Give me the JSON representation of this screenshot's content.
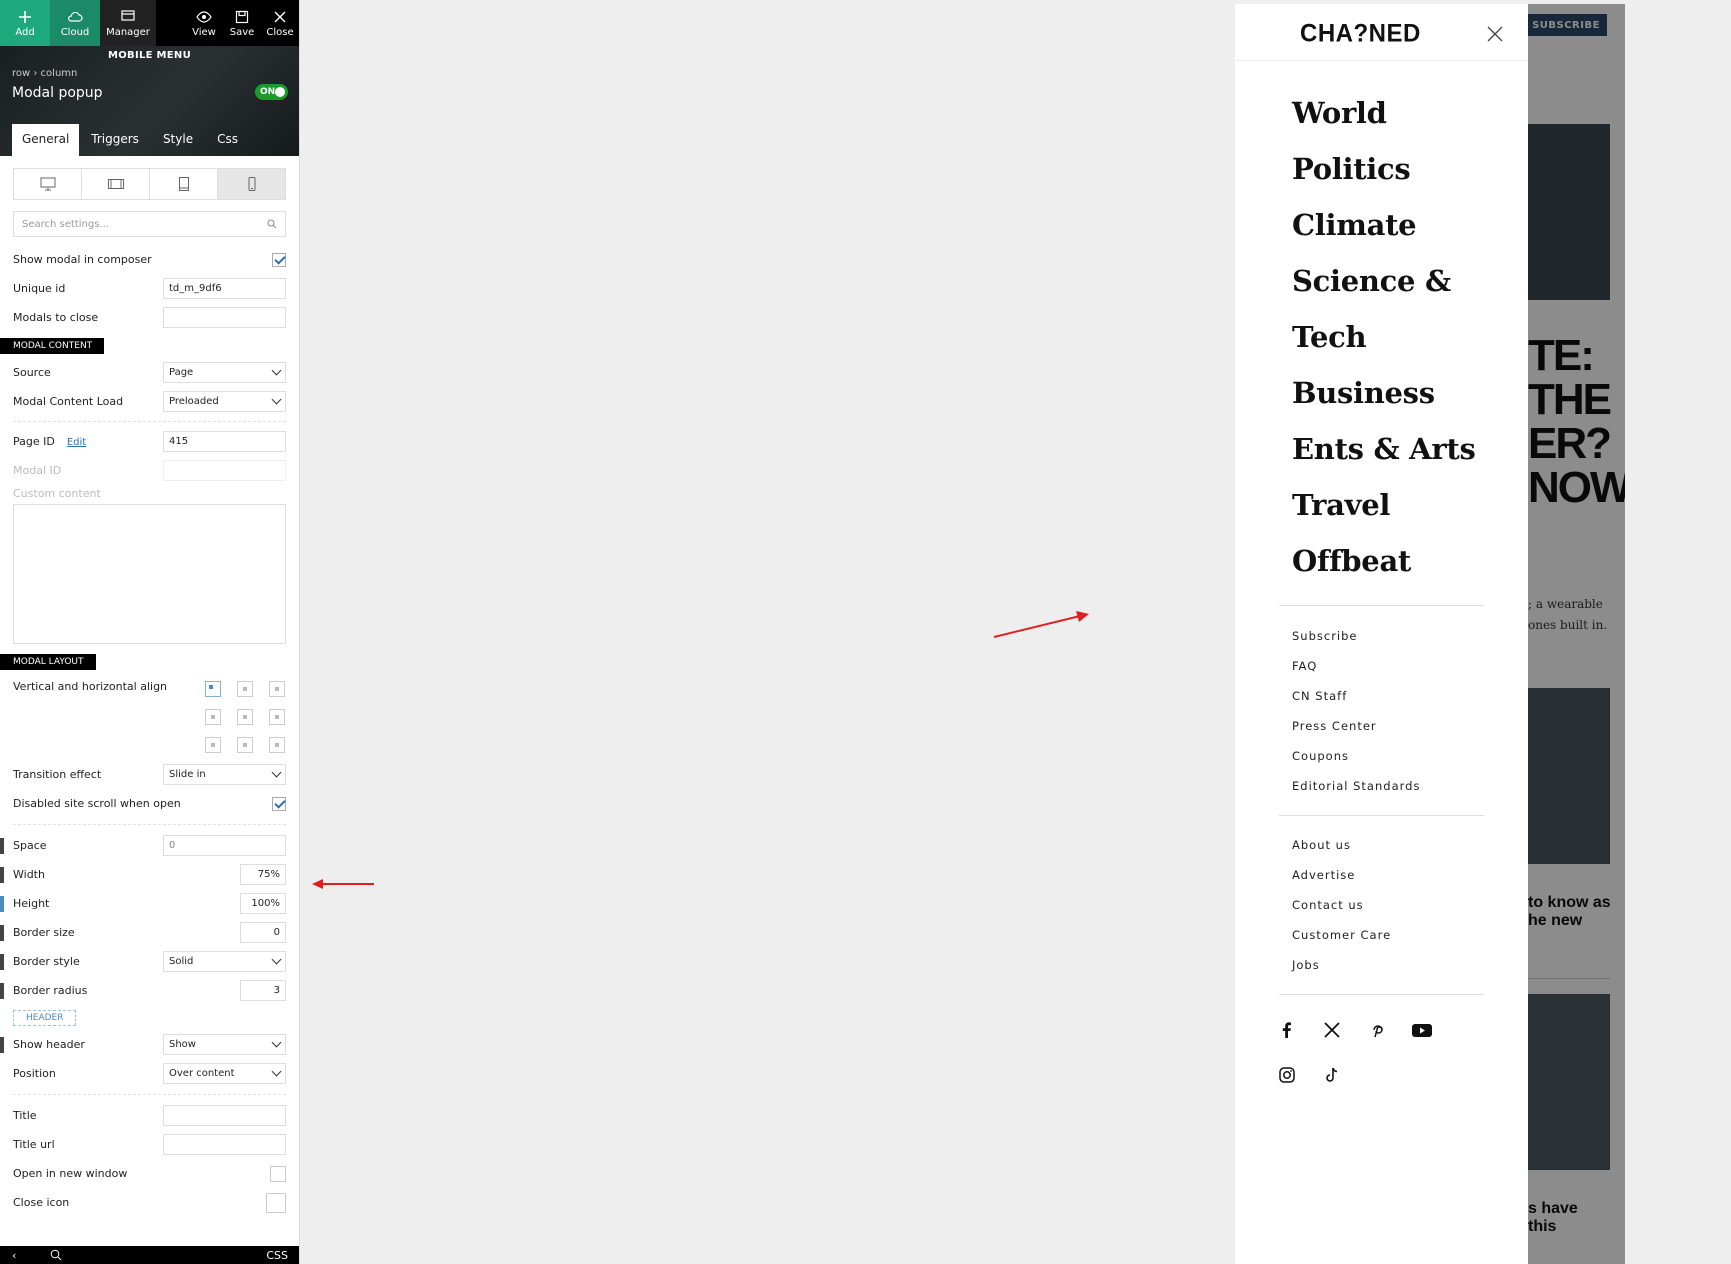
{
  "composer": {
    "toolbar": {
      "add": "Add",
      "cloud": "Cloud",
      "manager": "Manager",
      "view": "View",
      "save": "Save",
      "close": "Close"
    },
    "section_name": "MOBILE MENU",
    "breadcrumb": "row  ›  column",
    "element_title": "Modal popup",
    "toggle": "ON",
    "tabs": [
      "General",
      "Triggers",
      "Style",
      "Css"
    ],
    "search_placeholder": "Search settings...",
    "fields": {
      "show_modal": "Show modal in composer",
      "unique_id_label": "Unique id",
      "unique_id_value": "td_m_9df6",
      "modals_to_close": "Modals to close",
      "section_content": "MODAL CONTENT",
      "source_label": "Source",
      "source_value": "Page",
      "load_label": "Modal Content Load",
      "load_value": "Preloaded",
      "page_id_label": "Page ID",
      "page_id_edit": "Edit",
      "page_id_value": "415",
      "modal_id_label": "Modal ID",
      "custom_content_label": "Custom content",
      "section_layout": "MODAL LAYOUT",
      "align_label": "Vertical and horizontal align",
      "transition_label": "Transition effect",
      "transition_value": "Slide in",
      "disable_scroll_label": "Disabled site scroll when open",
      "space_label": "Space",
      "space_value": "0",
      "width_label": "Width",
      "width_value": "75%",
      "height_label": "Height",
      "height_value": "100%",
      "border_size_label": "Border size",
      "border_size_value": "0",
      "border_style_label": "Border style",
      "border_style_value": "Solid",
      "border_radius_label": "Border radius",
      "border_radius_value": "3",
      "section_header": "HEADER",
      "show_header_label": "Show header",
      "show_header_value": "Show",
      "position_label": "Position",
      "position_value": "Over content",
      "title_label": "Title",
      "title_url_label": "Title url",
      "new_window_label": "Open in new window",
      "close_icon_label": "Close icon"
    },
    "bottom_right": "CSS"
  },
  "site": {
    "subscribe_button": "SUBSCRIBE",
    "bg_headline": [
      "TE:",
      "THE",
      "ER?",
      "NOW"
    ],
    "bg_text": [
      "; a wearable",
      "ones built in."
    ],
    "bg_caption1": [
      "to know as",
      "he new"
    ],
    "bg_caption2": [
      "s have",
      "this"
    ]
  },
  "mobile_menu": {
    "logo": "CHA?NED",
    "main_items": [
      "World",
      "Politics",
      "Climate",
      "Science &",
      "Tech",
      "Business",
      "Ents & Arts",
      "Travel",
      "Offbeat"
    ],
    "links_1": [
      "Subscribe",
      "FAQ",
      "CN Staff",
      "Press Center",
      "Coupons",
      "Editorial Standards"
    ],
    "links_2": [
      "About us",
      "Advertise",
      "Contact us",
      "Customer Care",
      "Jobs"
    ],
    "social_icons": [
      "facebook-icon",
      "x-icon",
      "pinterest-icon",
      "youtube-icon",
      "instagram-icon",
      "tiktok-icon"
    ]
  },
  "colors": {
    "accent_green": "#1ea97c",
    "annotation_red": "#e02020",
    "section_black": "#000000",
    "link_blue": "#2b6fb6"
  }
}
